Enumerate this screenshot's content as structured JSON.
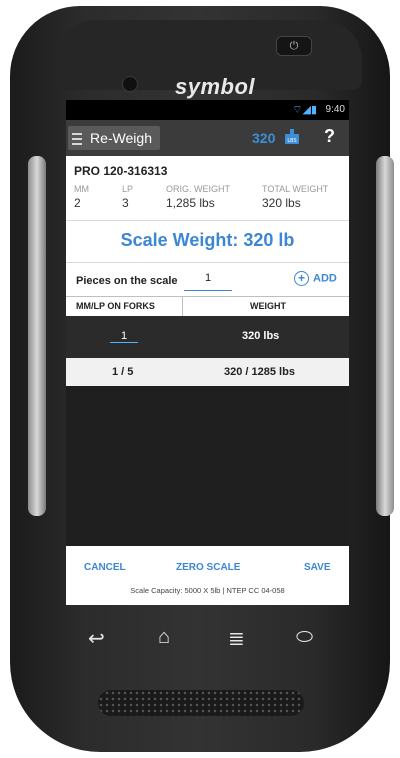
{
  "device": {
    "brand": "symbol",
    "power_icon": "power-icon"
  },
  "status_bar": {
    "time": "9:40",
    "icons": "wifi-signal-battery-icons"
  },
  "app_bar": {
    "title": "Re-Weigh",
    "weight": "320",
    "help": "?"
  },
  "record": {
    "pro": "PRO 120-316313",
    "mm_label": "MM",
    "mm": "2",
    "lp_label": "LP",
    "lp": "3",
    "orig_weight_label": "ORIG. WEIGHT",
    "orig_weight": "1,285 lbs",
    "total_weight_label": "TOTAL WEIGHT",
    "total_weight": "320 lbs"
  },
  "scale_weight": "Scale Weight: 320 lb",
  "pieces": {
    "label": "Pieces on the scale",
    "value": "1",
    "add": "ADD"
  },
  "table": {
    "headers": [
      "MM/LP ON FORKS",
      "WEIGHT"
    ],
    "row": {
      "forks": "1",
      "weight": "320 lbs"
    },
    "totals": {
      "left": "1 / 5",
      "right": "320 / 1285 lbs"
    }
  },
  "actions": {
    "cancel": "CANCEL",
    "zero": "ZERO SCALE",
    "save": "SAVE"
  },
  "footer": "Scale Capacity: 5000 X 5lb  |  NTEP CC 04-058",
  "colors": {
    "accent": "#3c86d4",
    "appbar": "#3b3b3b",
    "dark_row": "#2b2b2b"
  }
}
